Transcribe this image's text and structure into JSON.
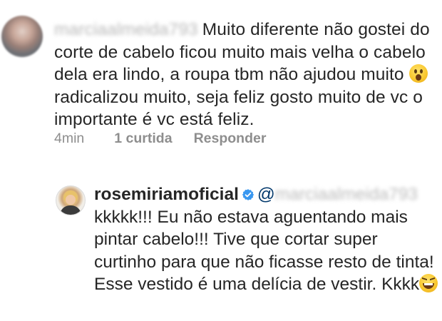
{
  "comment": {
    "username": "marciaalmeida793",
    "text_before_emoji": "Muito diferente não gostei do corte de cabelo ficou muito mais velha o cabelo dela era lindo, a roupa tbm não ajudou muito",
    "emoji": "hushed-face",
    "text_after_emoji": "radicalizou muito, seja feliz gosto muito de vc o importante é vc está feliz.",
    "time": "4min",
    "likes": "1 curtida",
    "reply_label": "Responder"
  },
  "reply": {
    "author": "rosemiriamoficial",
    "verified_icon": "verified-badge-icon",
    "mention": "@marciaalmeida793",
    "text": "kkkkk!!! Eu não estava aguentando mais pintar cabelo!!! Tive que cortar super curtinho para que não ficasse resto de tinta! Esse vestido é uma delícia de vestir. Kkkk",
    "emoji": "laughing-face"
  },
  "colors": {
    "text": "#262626",
    "meta": "#8e8e8e",
    "verified": "#3897f0",
    "mention": "#00376b"
  }
}
